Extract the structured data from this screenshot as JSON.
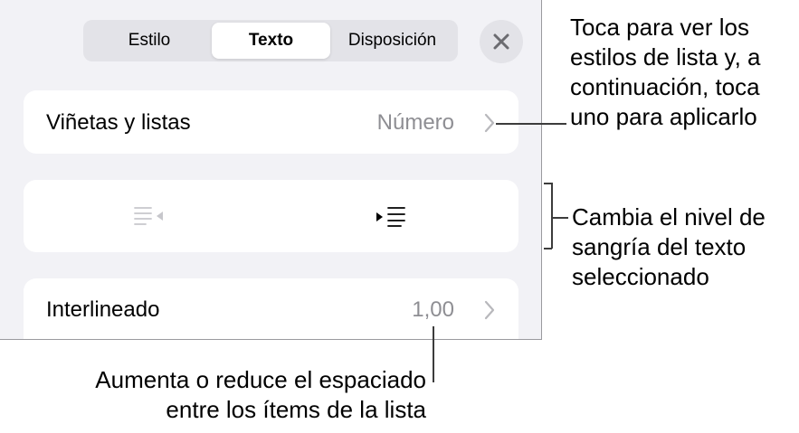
{
  "tabs": [
    {
      "label": "Estilo",
      "active": false
    },
    {
      "label": "Texto",
      "active": true
    },
    {
      "label": "Disposición",
      "active": false
    }
  ],
  "rows": {
    "bullets": {
      "label": "Viñetas y listas",
      "value": "Número"
    },
    "spacing": {
      "label": "Interlineado",
      "value": "1,00"
    }
  },
  "icons": {
    "close": "close-icon",
    "decrease_indent": "decrease-indent-icon",
    "increase_indent": "increase-indent-icon",
    "chevron": "chevron-right-icon"
  },
  "callouts": {
    "list_styles": [
      "Toca para ver los",
      "estilos de lista y, a",
      "continuación, toca",
      "uno para aplicarlo"
    ],
    "indent": [
      "Cambia el nivel de",
      "sangría del texto",
      "seleccionado"
    ],
    "spacing": [
      "Aumenta o reduce el espaciado",
      "entre los ítems de la lista"
    ]
  },
  "colors": {
    "panel_bg": "#f2f2f6",
    "segment_bg": "#e3e3e8",
    "secondary_text": "#8e8e93",
    "disabled_icon": "#c7c7cc"
  }
}
